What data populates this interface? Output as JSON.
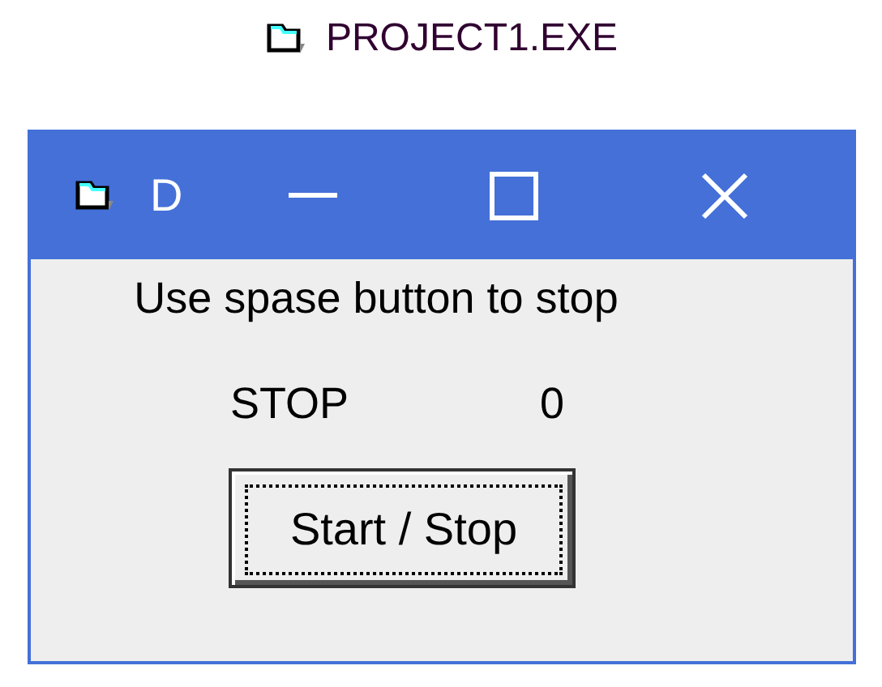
{
  "taskbar_label": {
    "title": "PROJECT1.EXE"
  },
  "window": {
    "title": "D"
  },
  "message": "Use spase button to stop",
  "status": {
    "label": "STOP",
    "value": "0"
  },
  "button": {
    "label": "Start / Stop",
    "focused": true
  }
}
